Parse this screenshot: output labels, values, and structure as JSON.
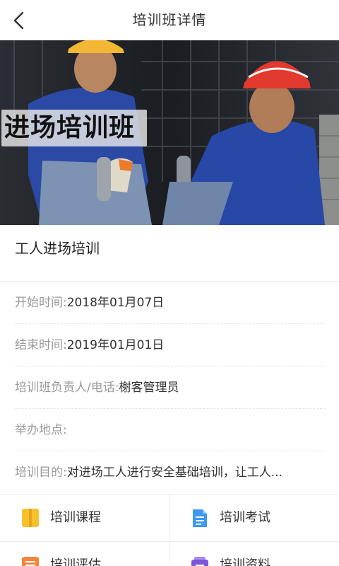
{
  "header": {
    "title": "培训班详情",
    "back_icon": "chevron-left-icon"
  },
  "banner": {
    "overlay_text": "进场培训班"
  },
  "course": {
    "name": "工人进场培训"
  },
  "details": [
    {
      "label": "开始时间:",
      "value": "2018年01月07日"
    },
    {
      "label": "结束时间:",
      "value": "2019年01月01日"
    },
    {
      "label": "培训班负责人/电话:",
      "value": "榭客管理员"
    },
    {
      "label": "举办地点:",
      "value": ""
    },
    {
      "label": "培训目的:",
      "value": "对进场工人进行安全基础培训，让工人..."
    }
  ],
  "menu": [
    {
      "label": "培训课程",
      "icon": "book-icon",
      "color": "#F6C12D"
    },
    {
      "label": "培训考试",
      "icon": "document-icon",
      "color": "#3D98F2"
    },
    {
      "label": "培训评估",
      "icon": "list-icon",
      "color": "#F3863A"
    },
    {
      "label": "培训资料",
      "icon": "folder-icon",
      "color": "#7A55D9"
    }
  ],
  "colors": {
    "helmet": "#E23A2E",
    "uniform": "#2848A8",
    "helmet_yellow": "#F2B833"
  }
}
